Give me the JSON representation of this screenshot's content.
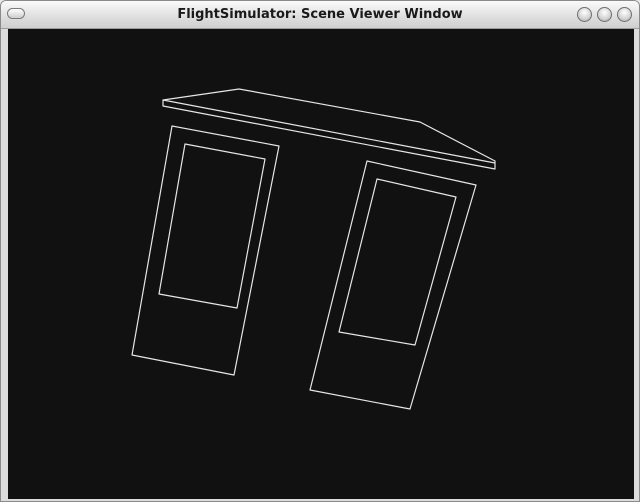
{
  "window": {
    "title": "FlightSimulator: Scene Viewer Window",
    "title_buttons": [
      "window-menu-icon",
      "minimize-icon",
      "maximize-icon",
      "close-icon"
    ]
  },
  "scene": {
    "background_color": "#111111",
    "line_color": "#e6e6e6",
    "objects": [
      "roof-canopy",
      "left-door-panel",
      "right-door-panel"
    ]
  }
}
